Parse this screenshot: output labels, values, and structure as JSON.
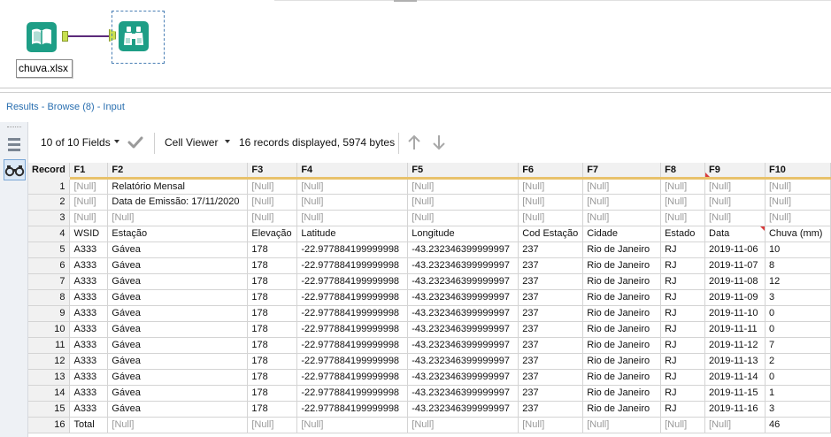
{
  "canvas": {
    "input_tool_label": "chuva.xlsx",
    "input_icon": "book-icon",
    "browse_icon": "binoculars-icon"
  },
  "results": {
    "title": "Results - Browse (8) - Input"
  },
  "toolbar": {
    "fields_label": "10 of 10 Fields",
    "cell_viewer_label": "Cell Viewer",
    "summary": "16 records displayed, 5974 bytes"
  },
  "colors": {
    "tool_green": "#1e9e86",
    "connector": "#5c2a7a",
    "anchor": "#c8e050",
    "title_blue": "#2a6fb0"
  },
  "grid": {
    "columns": [
      "Record",
      "F1",
      "F2",
      "F3",
      "F4",
      "F5",
      "F6",
      "F7",
      "F8",
      "F9",
      "F10"
    ],
    "rows": [
      [
        "1",
        "[Null]",
        "Relatório Mensal",
        "[Null]",
        "[Null]",
        "[Null]",
        "[Null]",
        "[Null]",
        "[Null]",
        "[Null]",
        "[Null]"
      ],
      [
        "2",
        "[Null]",
        "Data de Emissão: 17/11/2020",
        "[Null]",
        "[Null]",
        "[Null]",
        "[Null]",
        "[Null]",
        "[Null]",
        "[Null]",
        "[Null]"
      ],
      [
        "3",
        "[Null]",
        "[Null]",
        "[Null]",
        "[Null]",
        "[Null]",
        "[Null]",
        "[Null]",
        "[Null]",
        "[Null]",
        "[Null]"
      ],
      [
        "4",
        "WSID",
        "Estação",
        "Elevação",
        "Latitude",
        "Longitude",
        "Cod Estação",
        "Cidade",
        "Estado",
        "Data",
        "Chuva (mm)"
      ],
      [
        "5",
        "A333",
        "Gávea",
        "178",
        "-22.977884199999998",
        "-43.232346399999997",
        "237",
        "Rio de Janeiro",
        "RJ",
        "2019-11-06",
        "10"
      ],
      [
        "6",
        "A333",
        "Gávea",
        "178",
        "-22.977884199999998",
        "-43.232346399999997",
        "237",
        "Rio de Janeiro",
        "RJ",
        "2019-11-07",
        "8"
      ],
      [
        "7",
        "A333",
        "Gávea",
        "178",
        "-22.977884199999998",
        "-43.232346399999997",
        "237",
        "Rio de Janeiro",
        "RJ",
        "2019-11-08",
        "12"
      ],
      [
        "8",
        "A333",
        "Gávea",
        "178",
        "-22.977884199999998",
        "-43.232346399999997",
        "237",
        "Rio de Janeiro",
        "RJ",
        "2019-11-09",
        "3"
      ],
      [
        "9",
        "A333",
        "Gávea",
        "178",
        "-22.977884199999998",
        "-43.232346399999997",
        "237",
        "Rio de Janeiro",
        "RJ",
        "2019-11-10",
        "0"
      ],
      [
        "10",
        "A333",
        "Gávea",
        "178",
        "-22.977884199999998",
        "-43.232346399999997",
        "237",
        "Rio de Janeiro",
        "RJ",
        "2019-11-11",
        "0"
      ],
      [
        "11",
        "A333",
        "Gávea",
        "178",
        "-22.977884199999998",
        "-43.232346399999997",
        "237",
        "Rio de Janeiro",
        "RJ",
        "2019-11-12",
        "7"
      ],
      [
        "12",
        "A333",
        "Gávea",
        "178",
        "-22.977884199999998",
        "-43.232346399999997",
        "237",
        "Rio de Janeiro",
        "RJ",
        "2019-11-13",
        "2"
      ],
      [
        "13",
        "A333",
        "Gávea",
        "178",
        "-22.977884199999998",
        "-43.232346399999997",
        "237",
        "Rio de Janeiro",
        "RJ",
        "2019-11-14",
        "0"
      ],
      [
        "14",
        "A333",
        "Gávea",
        "178",
        "-22.977884199999998",
        "-43.232346399999997",
        "237",
        "Rio de Janeiro",
        "RJ",
        "2019-11-15",
        "1"
      ],
      [
        "15",
        "A333",
        "Gávea",
        "178",
        "-22.977884199999998",
        "-43.232346399999997",
        "237",
        "Rio de Janeiro",
        "RJ",
        "2019-11-16",
        "3"
      ],
      [
        "16",
        "Total",
        "[Null]",
        "[Null]",
        "[Null]",
        "[Null]",
        "[Null]",
        "[Null]",
        "[Null]",
        "[Null]",
        "46"
      ]
    ]
  }
}
